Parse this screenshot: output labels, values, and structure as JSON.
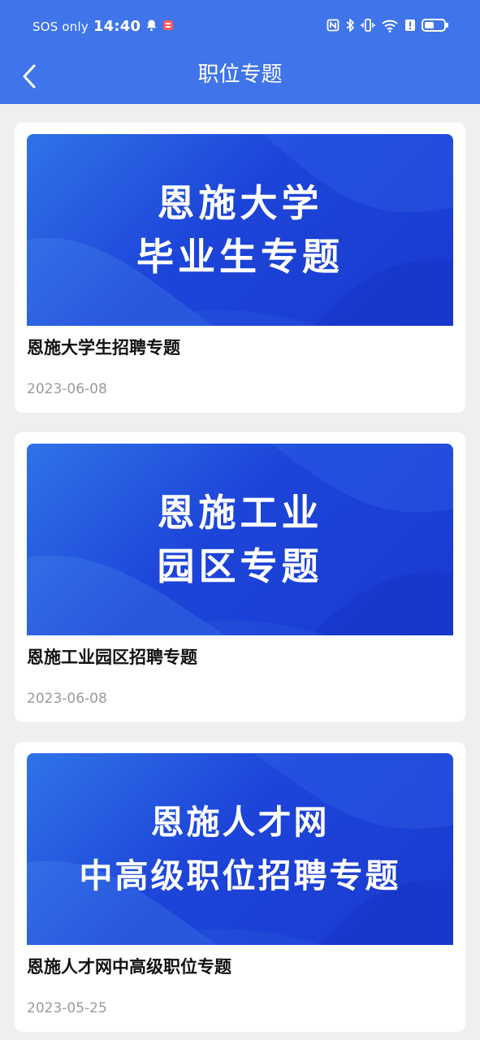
{
  "status_bar": {
    "carrier": "SOS only",
    "time": "14:40",
    "icons": [
      "bell-icon",
      "app-notification-icon",
      "nfc-icon",
      "bluetooth-icon",
      "vibrate-icon",
      "wifi-icon",
      "alert-icon",
      "battery-icon"
    ]
  },
  "header": {
    "title": "职位专题",
    "back_icon": "chevron-left-icon",
    "background": "#3f74ea"
  },
  "topics": [
    {
      "banner_lines": [
        "恩施大学",
        "毕业生专题"
      ],
      "title": "恩施大学生招聘专题",
      "date": "2023-06-08"
    },
    {
      "banner_lines": [
        "恩施工业",
        "园区专题"
      ],
      "title": "恩施工业园区招聘专题",
      "date": "2023-06-08"
    },
    {
      "banner_lines": [
        "恩施人才网",
        "中高级职位招聘专题"
      ],
      "title": "恩施人才网中高级职位专题",
      "date": "2023-05-25"
    }
  ],
  "colors": {
    "page_background": "#efefef",
    "card_background": "#ffffff",
    "banner_blue": "#1d44d8",
    "date_gray": "#9a9a9a"
  }
}
